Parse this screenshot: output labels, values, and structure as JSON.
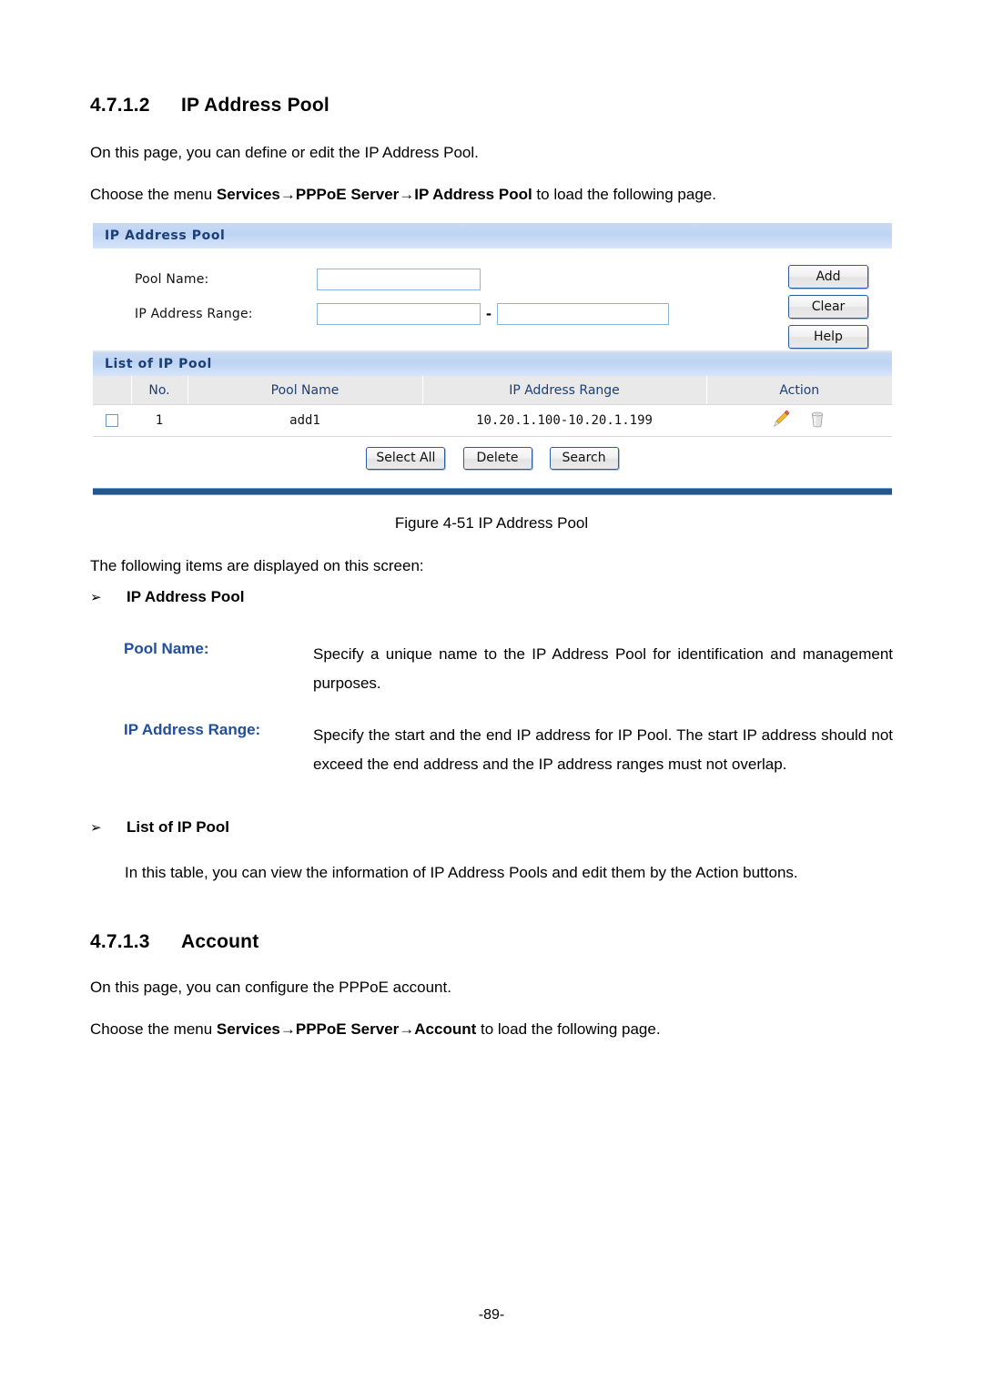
{
  "document": {
    "section_1": {
      "number": "4.7.1.2",
      "title": "IP Address Pool",
      "intro": "On this page, you can define or edit the IP Address Pool.",
      "menu_prefix": "Choose the menu ",
      "menu_path": "Services→PPPoE Server→IP Address Pool",
      "menu_suffix": " to load the following page."
    },
    "figure_caption": "Figure 4-51 IP Address Pool",
    "items_intro": "The following items are displayed on this screen:",
    "bullets": [
      {
        "arrow": "➢",
        "label": "IP Address Pool"
      },
      {
        "arrow": "➢",
        "label": "List of IP Pool"
      }
    ],
    "terms": [
      {
        "label": "Pool Name:",
        "text": "Specify a unique name to the IP Address Pool for identification and management purposes."
      },
      {
        "label": "IP Address Range:",
        "text": "Specify the start and the end IP address for IP Pool. The start IP address should not exceed the end address and the IP address ranges must not overlap."
      }
    ],
    "list_of_ip_pool_text": "In this table, you can view the information of IP Address Pools and edit them by the Action buttons.",
    "section_2": {
      "number": "4.7.1.3",
      "title": "Account",
      "intro": "On this page, you can configure the PPPoE account.",
      "menu_prefix": "Choose the menu ",
      "menu_path": "Services→PPPoE Server→Account",
      "menu_suffix": " to load the following page."
    },
    "page_number": "-89-"
  },
  "screenshot": {
    "panel_title": "IP Address Pool",
    "form": {
      "pool_name_label": "Pool Name:",
      "pool_name_value": "",
      "pool_name_placeholder": "",
      "ip_range_label": "IP Address Range:",
      "ip_range_start_value": "",
      "ip_range_end_value": "",
      "range_separator": "-"
    },
    "side_buttons": [
      {
        "label": "Add"
      },
      {
        "label": "Clear"
      },
      {
        "label": "Help"
      }
    ],
    "list_title": "List of IP Pool",
    "table": {
      "columns": [
        "",
        "No.",
        "Pool Name",
        "IP Address Range",
        "Action"
      ],
      "rows": [
        {
          "checked": false,
          "no": "1",
          "pool_name": "add1",
          "ip_range": "10.20.1.100-10.20.1.199",
          "actions": [
            "edit-icon",
            "delete-icon"
          ]
        }
      ]
    },
    "table_buttons": [
      {
        "label": "Select All"
      },
      {
        "label": "Delete"
      },
      {
        "label": "Search"
      }
    ],
    "colors": {
      "header_blue": "#bed4f2",
      "header_text": "#1c3e77",
      "table_header_bg": "#e9e9e9",
      "input_border": "#8fb4d9",
      "button_border": "#2a5f9e",
      "footer_bar": "#23578c",
      "edit_icon": "#f0a21a",
      "delete_icon": "#b9b9b9"
    }
  }
}
